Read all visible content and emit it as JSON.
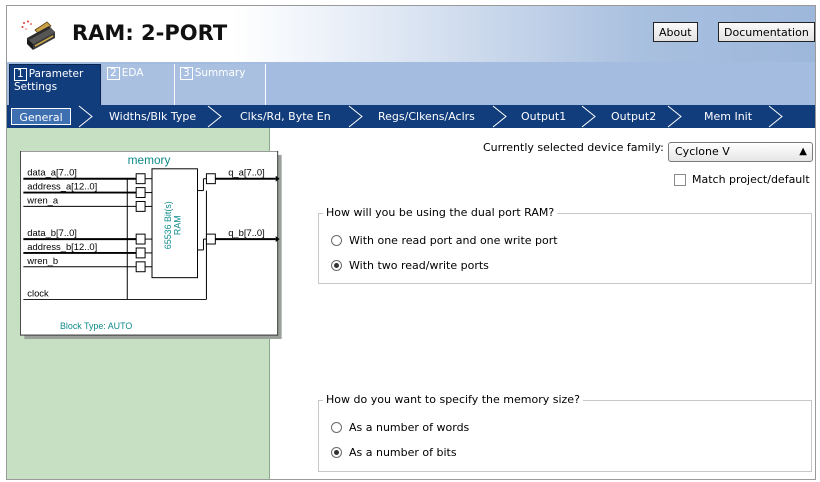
{
  "header": {
    "title": "RAM: 2-PORT",
    "about_label": "About",
    "documentation_label": "Documentation"
  },
  "tabs": [
    {
      "num": "1",
      "label": "Parameter Settings",
      "active": true
    },
    {
      "num": "2",
      "label": "EDA",
      "active": false
    },
    {
      "num": "3",
      "label": "Summary",
      "active": false
    }
  ],
  "subnav": [
    "General",
    "Widths/Blk Type",
    "Clks/Rd, Byte En",
    "Regs/Clkens/Aclrs",
    "Output1",
    "Output2",
    "Mem Init"
  ],
  "block_diagram": {
    "title": "memory",
    "inputs_a": [
      "data_a[7..0]",
      "address_a[12..0]",
      "wren_a"
    ],
    "inputs_b": [
      "data_b[7..0]",
      "address_b[12..0]",
      "wren_b"
    ],
    "clock": "clock",
    "output_a": "q_a[7..0]",
    "output_b": "q_b[7..0]",
    "ram_label_1": "65536 Bit(s)",
    "ram_label_2": "RAM",
    "block_type": "Block Type: AUTO"
  },
  "device": {
    "label": "Currently selected device family:",
    "value": "Cyclone V",
    "match_label": "Match project/default",
    "match_checked": false
  },
  "usage_group": {
    "title": "How will you be using the dual port RAM?",
    "options": [
      "With one read port and one write port",
      "With two read/write ports"
    ],
    "selected": 1
  },
  "size_group": {
    "title": "How do you want to specify the memory size?",
    "options": [
      "As a number of words",
      "As a number of bits"
    ],
    "selected": 1
  },
  "colors": {
    "nav_dark": "#123d7c",
    "nav_light": "#a3bcdf",
    "left_panel": "#c7e0c4",
    "block_teal": "#0f8a8a"
  }
}
